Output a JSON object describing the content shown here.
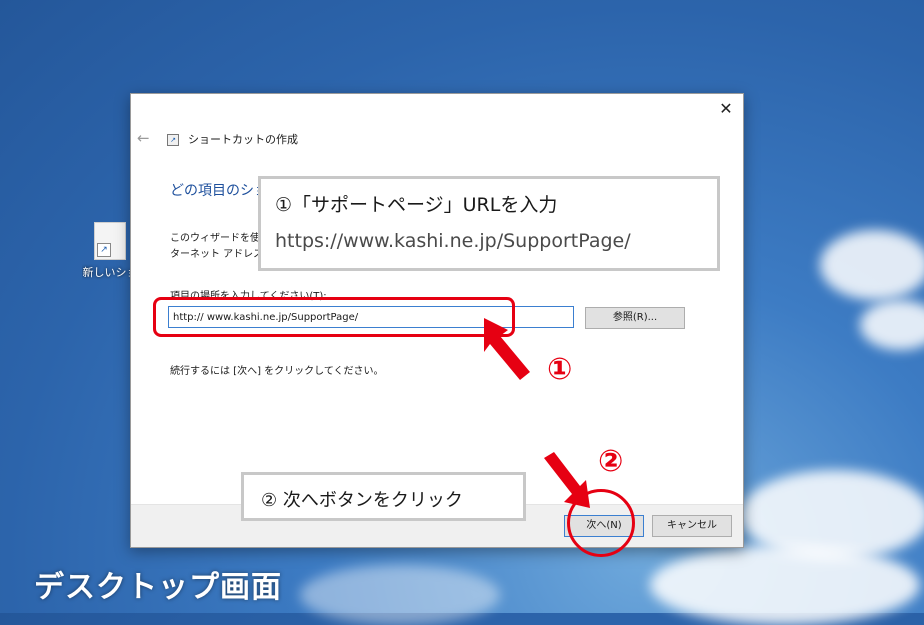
{
  "desktop": {
    "icon_label": "新しいショ",
    "caption": "デスクトップ画面"
  },
  "dialog": {
    "wizard_title": "ショートカットの作成",
    "heading": "どの項目のショ",
    "description_lines": [
      "このウィザードを使用",
      "ターネット アドレスへ"
    ],
    "location_label": "項目の場所を入力してください(T):",
    "location_value": "http:// www.kashi.ne.jp/SupportPage/",
    "browse_label": "参照(R)...",
    "continue_text": "続行するには [次へ] をクリックしてください。",
    "next_label": "次へ(N)",
    "cancel_label": "キャンセル",
    "close_glyph": "✕",
    "back_glyph": "←"
  },
  "annotations": {
    "callout1_line1": "①「サポートページ」URLを入力",
    "callout1_line2": "https://www.kashi.ne.jp/SupportPage/",
    "callout2_line": "② 次へボタンをクリック",
    "marker1": "①",
    "marker2": "②",
    "accent_color": "#e60012"
  }
}
